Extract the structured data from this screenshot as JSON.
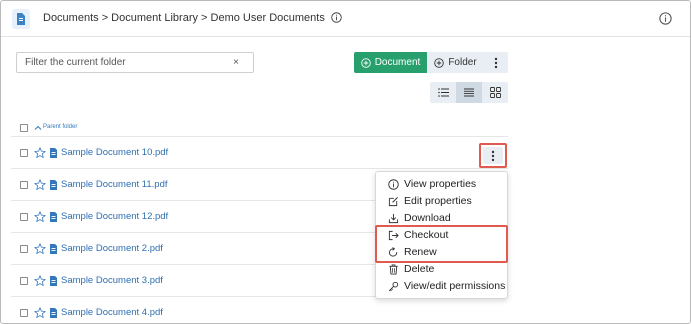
{
  "header": {
    "breadcrumb": "Documents > Document Library > Demo User Documents",
    "app_icon": "document-app-icon",
    "info_icon": "info-icon"
  },
  "toolbar": {
    "filter_placeholder": "Filter the current folder",
    "clear_label": "×",
    "document_button_label": "Document",
    "folder_button_label": "Folder",
    "accent_color": "#28a06e"
  },
  "view_modes": [
    "list-view-icon",
    "detail-view-icon",
    "grid-view-icon"
  ],
  "list": {
    "parent_folder_label": "Parent folder",
    "files": [
      "Sample Document 10.pdf",
      "Sample Document 11.pdf",
      "Sample Document 12.pdf",
      "Sample Document 2.pdf",
      "Sample Document 3.pdf",
      "Sample Document 4.pdf"
    ]
  },
  "context_menu": {
    "items": [
      "View properties",
      "Edit properties",
      "Download",
      "Checkout",
      "Renew",
      "Delete",
      "View/edit permissions"
    ],
    "highlight_color": "#e05a50"
  }
}
